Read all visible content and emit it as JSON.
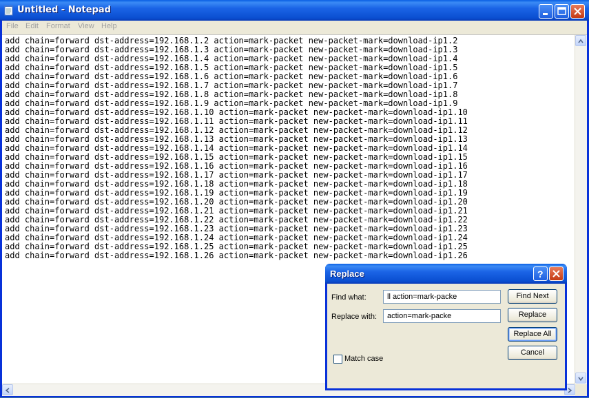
{
  "window": {
    "title": "Untitled - Notepad",
    "colors": {
      "title_bar": "#0a4ed0",
      "client": "#ece9d8",
      "text_area": "#ffffff"
    }
  },
  "menu": {
    "items": [
      {
        "label": "File"
      },
      {
        "label": "Edit"
      },
      {
        "label": "Format"
      },
      {
        "label": "View"
      },
      {
        "label": "Help"
      }
    ]
  },
  "editor": {
    "lines": [
      "add chain=forward dst-address=192.168.1.2 action=mark-packet new-packet-mark=download-ip1.2",
      "add chain=forward dst-address=192.168.1.3 action=mark-packet new-packet-mark=download-ip1.3",
      "add chain=forward dst-address=192.168.1.4 action=mark-packet new-packet-mark=download-ip1.4",
      "add chain=forward dst-address=192.168.1.5 action=mark-packet new-packet-mark=download-ip1.5",
      "add chain=forward dst-address=192.168.1.6 action=mark-packet new-packet-mark=download-ip1.6",
      "add chain=forward dst-address=192.168.1.7 action=mark-packet new-packet-mark=download-ip1.7",
      "add chain=forward dst-address=192.168.1.8 action=mark-packet new-packet-mark=download-ip1.8",
      "add chain=forward dst-address=192.168.1.9 action=mark-packet new-packet-mark=download-ip1.9",
      "add chain=forward dst-address=192.168.1.10 action=mark-packet new-packet-mark=download-ip1.10",
      "add chain=forward dst-address=192.168.1.11 action=mark-packet new-packet-mark=download-ip1.11",
      "add chain=forward dst-address=192.168.1.12 action=mark-packet new-packet-mark=download-ip1.12",
      "add chain=forward dst-address=192.168.1.13 action=mark-packet new-packet-mark=download-ip1.13",
      "add chain=forward dst-address=192.168.1.14 action=mark-packet new-packet-mark=download-ip1.14",
      "add chain=forward dst-address=192.168.1.15 action=mark-packet new-packet-mark=download-ip1.15",
      "add chain=forward dst-address=192.168.1.16 action=mark-packet new-packet-mark=download-ip1.16",
      "add chain=forward dst-address=192.168.1.17 action=mark-packet new-packet-mark=download-ip1.17",
      "add chain=forward dst-address=192.168.1.18 action=mark-packet new-packet-mark=download-ip1.18",
      "add chain=forward dst-address=192.168.1.19 action=mark-packet new-packet-mark=download-ip1.19",
      "add chain=forward dst-address=192.168.1.20 action=mark-packet new-packet-mark=download-ip1.20",
      "add chain=forward dst-address=192.168.1.21 action=mark-packet new-packet-mark=download-ip1.21",
      "add chain=forward dst-address=192.168.1.22 action=mark-packet new-packet-mark=download-ip1.22",
      "add chain=forward dst-address=192.168.1.23 action=mark-packet new-packet-mark=download-ip1.23",
      "add chain=forward dst-address=192.168.1.24 action=mark-packet new-packet-mark=download-ip1.24",
      "add chain=forward dst-address=192.168.1.25 action=mark-packet new-packet-mark=download-ip1.25",
      "add chain=forward dst-address=192.168.1.26 action=mark-packet new-packet-mark=download-ip1.26"
    ]
  },
  "dialog": {
    "title": "Replace",
    "find_label": "Find what:",
    "find_value": "ll action=mark-packe",
    "replace_label": "Replace with:",
    "replace_value": "action=mark-packe",
    "match_case_label": "Match case",
    "match_case_checked": false,
    "buttons": {
      "find_next": "Find Next",
      "replace": "Replace",
      "replace_all": "Replace All",
      "cancel": "Cancel"
    }
  },
  "icons": {
    "app": "notepad-icon",
    "minimize": "minimize-icon",
    "maximize": "maximize-icon",
    "close": "close-icon",
    "help": "help-icon",
    "scroll_up": "arrow-up-icon",
    "scroll_down": "arrow-down-icon",
    "scroll_left": "arrow-left-icon",
    "scroll_right": "arrow-right-icon"
  }
}
